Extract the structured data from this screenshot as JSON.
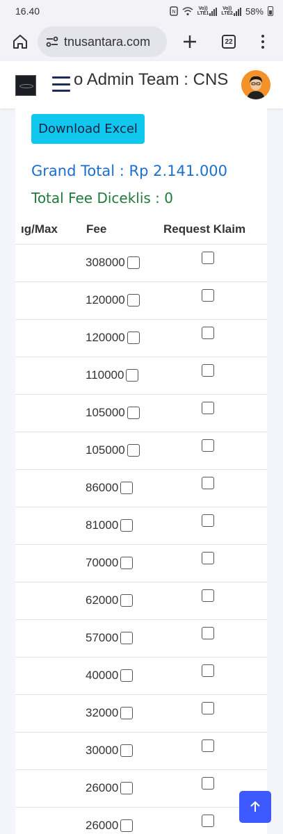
{
  "status_bar": {
    "time": "16.40",
    "battery": "58%",
    "sim1_label": "LTE1",
    "sim2_label": "LTE2",
    "volte_label": "Vo))"
  },
  "browser": {
    "url": "tnusantara.com",
    "tab_count": "22"
  },
  "header": {
    "title": "o Admin Team : CNS"
  },
  "main": {
    "download_button": "Download Excel",
    "grand_total": "Grand Total : Rp 2.141.000",
    "total_fee": "Total Fee Diceklis : 0",
    "table": {
      "columns": [
        "ıg/Max",
        "Fee",
        "Request Klaim"
      ],
      "rows": [
        {
          "fee": "308000"
        },
        {
          "fee": "120000"
        },
        {
          "fee": "120000"
        },
        {
          "fee": "110000"
        },
        {
          "fee": "105000"
        },
        {
          "fee": "105000"
        },
        {
          "fee": "86000"
        },
        {
          "fee": "81000"
        },
        {
          "fee": "70000"
        },
        {
          "fee": "62000"
        },
        {
          "fee": "57000"
        },
        {
          "fee": "40000"
        },
        {
          "fee": "32000"
        },
        {
          "fee": "30000"
        },
        {
          "fee": "26000"
        },
        {
          "fee": "26000"
        }
      ]
    }
  },
  "colors": {
    "download_button_bg": "#10c8ee",
    "grand_total_text": "#1a6fd2",
    "total_fee_text": "#1f7a3c",
    "scroll_top_bg": "#3d5afe"
  },
  "icons": {
    "home": "home-icon",
    "site_settings": "site-settings-icon",
    "new_tab": "plus-icon",
    "tabs": "tab-switcher-icon",
    "menu": "more-vertical-icon",
    "hamburger": "hamburger-menu-icon",
    "scroll_top": "arrow-up-icon"
  }
}
